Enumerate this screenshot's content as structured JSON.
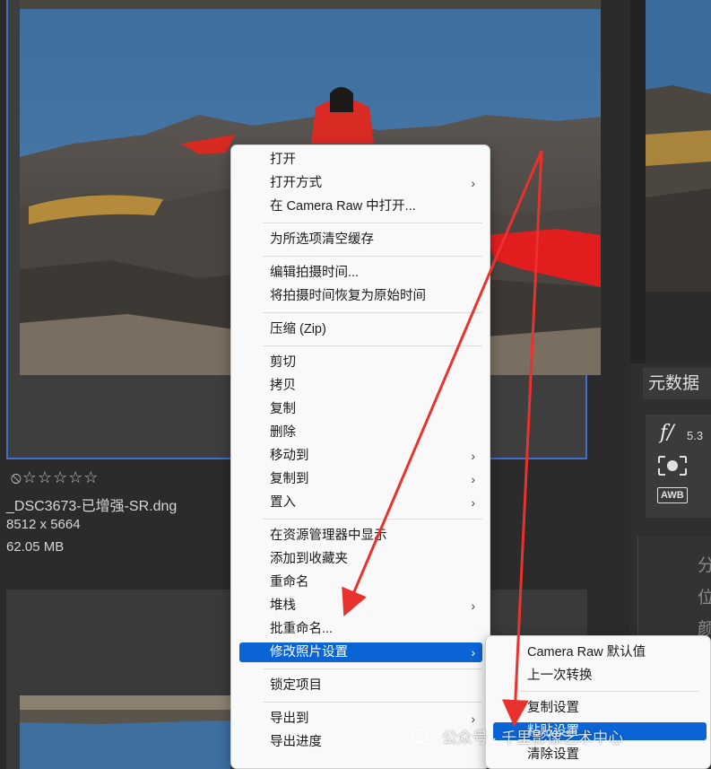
{
  "file": {
    "rating_stars": "⦸☆☆☆☆☆",
    "name": "_DSC3673-已增强-SR.dng",
    "dimensions": "8512 x 5664",
    "size": "62.05 MB"
  },
  "right_panel": {
    "tab_label": "元数据",
    "aperture_symbol": "f/",
    "aperture_value": "5.3",
    "awb_label": "AWB",
    "side_chars": [
      "分",
      "位",
      "颜"
    ]
  },
  "context_menu": {
    "items": [
      {
        "label": "打开"
      },
      {
        "label": "打开方式",
        "submenu": true
      },
      {
        "label": "在 Camera Raw 中打开..."
      },
      {
        "label": "为所选项清空缓存"
      },
      {
        "label": "编辑拍摄时间..."
      },
      {
        "label": "将拍摄时间恢复为原始时间"
      },
      {
        "label": "压缩 (Zip)"
      },
      {
        "label": "剪切"
      },
      {
        "label": "拷贝"
      },
      {
        "label": "复制"
      },
      {
        "label": "删除"
      },
      {
        "label": "移动到",
        "submenu": true
      },
      {
        "label": "复制到",
        "submenu": true
      },
      {
        "label": "置入",
        "submenu": true
      },
      {
        "label": "在资源管理器中显示"
      },
      {
        "label": "添加到收藏夹"
      },
      {
        "label": "重命名"
      },
      {
        "label": "堆栈",
        "submenu": true
      },
      {
        "label": "批重命名..."
      },
      {
        "label": "修改照片设置",
        "submenu": true,
        "highlighted": true
      },
      {
        "label": "锁定项目"
      },
      {
        "label": "导出到",
        "submenu": true
      },
      {
        "label": "导出进度"
      }
    ],
    "chevron": "›"
  },
  "submenu": {
    "items": [
      {
        "label": "Camera Raw 默认值"
      },
      {
        "label": "上一次转换"
      },
      {
        "label": "复制设置"
      },
      {
        "label": "粘贴设置",
        "highlighted": true
      },
      {
        "label": "清除设置"
      }
    ]
  },
  "watermark": {
    "text": "公众号 · 千里影像艺术中心"
  },
  "colors": {
    "highlight": "#0a64d6",
    "selection_border": "#3f6fd0",
    "arrow": "#e8322d"
  }
}
